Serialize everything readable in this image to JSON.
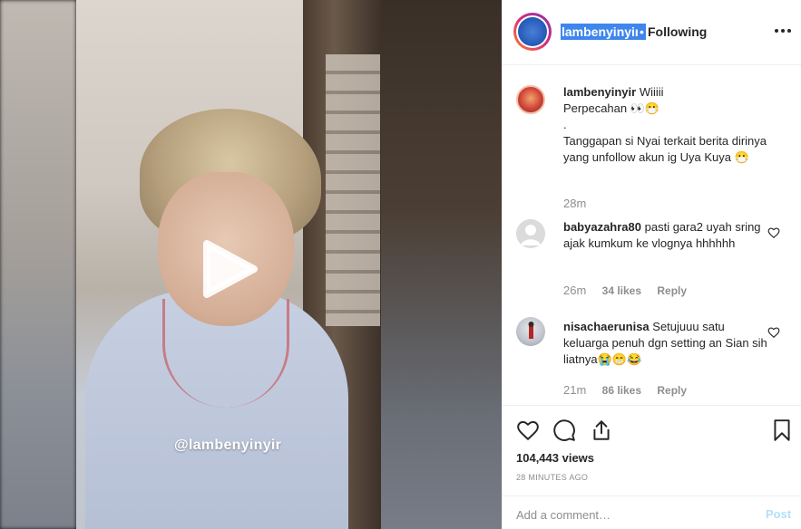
{
  "media": {
    "watermark": "@lambenyinyir",
    "play_icon": "play-icon"
  },
  "header": {
    "username": "lambenyinyir",
    "separator": "•",
    "follow_status": "Following",
    "more_icon": "more-horizontal-icon"
  },
  "caption": {
    "username": "lambenyinyir",
    "line1": "Wiiiii",
    "line2": "Perpecahan 👀😷",
    "line3": ".",
    "line4": "Tanggapan si Nyai terkait berita dirinya yang unfollow akun ig Uya Kuya 😷",
    "time": "28m"
  },
  "comments": [
    {
      "username": "babyazahra80",
      "text": "pasti gara2 uyah sring ajak kumkum ke vlognya hhhhhh",
      "time": "26m",
      "likes": "34 likes",
      "reply": "Reply"
    },
    {
      "username": "nisachaerunisa",
      "text": "Setujuuu satu keluarga penuh dgn setting an Sian sih liatnya😭😁😂",
      "time": "21m",
      "likes": "86 likes",
      "reply": "Reply"
    }
  ],
  "actions": {
    "views": "104,443 views",
    "timestamp": "28 MINUTES AGO"
  },
  "add_comment": {
    "placeholder": "Add a comment…",
    "post_label": "Post"
  },
  "colors": {
    "selection": "#3e86ec",
    "muted": "#8e8e8e",
    "post_disabled": "#b2dffc",
    "border": "#efefef"
  }
}
